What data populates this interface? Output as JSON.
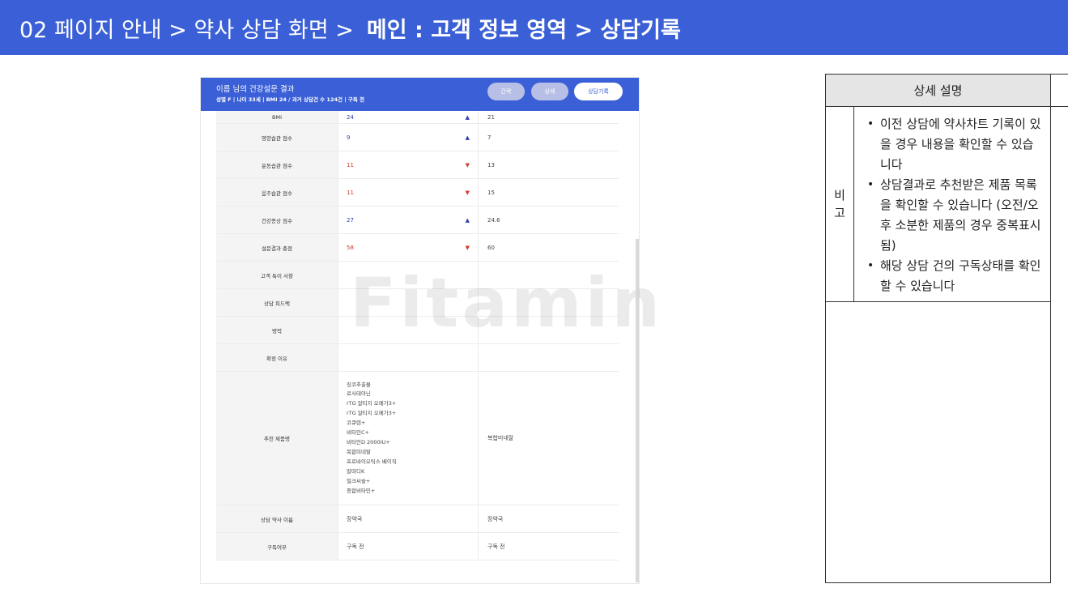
{
  "header": {
    "crumbs_normal": "02 페이지 안내 > 약사 상담 화면 >",
    "crumbs_bold": "메인 : 고객 정보 영역 > 상담기록"
  },
  "panel": {
    "title": "이름 님의 건강설문 결과",
    "meta": "성별 F | 나이 33세 | BMI 24   / 과거 상담건 수 124건 | 구독 전",
    "buttons": [
      "간략",
      "상세",
      "상담기록"
    ],
    "watermark": "Fitamin",
    "rows": [
      {
        "label": "BMI",
        "a": "24",
        "a_color": "blue",
        "arrow": "up",
        "b": "21"
      },
      {
        "label": "영양습관 점수",
        "a": "9",
        "a_color": "blue",
        "arrow": "up",
        "b": "7"
      },
      {
        "label": "운동습관 점수",
        "a": "11",
        "a_color": "red",
        "arrow": "down",
        "b": "13"
      },
      {
        "label": "음주습관 점수",
        "a": "11",
        "a_color": "red",
        "arrow": "down",
        "b": "15"
      },
      {
        "label": "건강증상 점수",
        "a": "27",
        "a_color": "blue",
        "arrow": "up",
        "b": "24.6"
      },
      {
        "label": "설문결과 총점",
        "a": "58",
        "a_color": "red",
        "arrow": "down",
        "b": "60"
      },
      {
        "label": "고객 특이 사항",
        "a": "",
        "b": ""
      },
      {
        "label": "상담 피드백",
        "a": "",
        "b": ""
      },
      {
        "label": "병력",
        "a": "",
        "b": ""
      },
      {
        "label": "확정 이유",
        "a": "",
        "b": ""
      }
    ],
    "products": {
      "label": "추천 제품명",
      "list_a": [
        "징코추출물",
        "로사테아닌",
        "rTG 알티지 오메가3+",
        "rTG 알티지 오메가3+",
        "코큐텐+",
        "비타민C+",
        "비타민D 2000IU+",
        "복합미네랄",
        "프로바이오틱스 베이직",
        "칼마디K",
        "밀크씨슬+",
        "종합비타민+"
      ],
      "b": "복합미네랄"
    },
    "pharmacist": {
      "label": "상담 약사 이름",
      "a": "장약국",
      "b": "장약국"
    },
    "subscription": {
      "label": "구독여부",
      "a": "구독 전",
      "b": "구독 전"
    }
  },
  "description": {
    "title": "상세 설명",
    "side": [
      "비",
      "고"
    ],
    "items": [
      "이전 상담에 약사차트 기록이 있을 경우 내용을 확인할 수 있습니다",
      "상담결과로 추천받은 제품 목록을 확인할 수 있습니다 (오전/오후 소분한 제품의 경우 중복표시됨)",
      "해당 상담 건의 구독상태를 확인할 수 있습니다"
    ]
  }
}
